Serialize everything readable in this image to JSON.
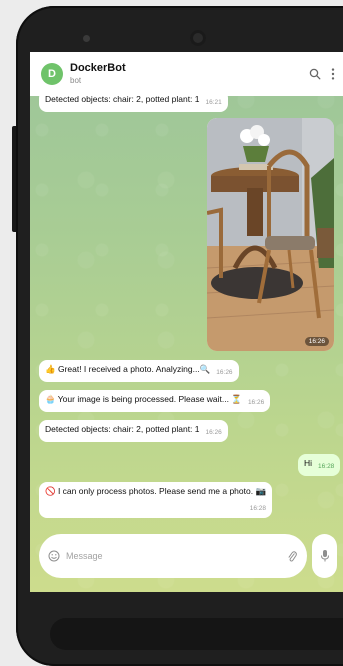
{
  "header": {
    "avatar_letter": "D",
    "title": "DockerBot",
    "subtitle": "bot"
  },
  "messages": [
    {
      "text": "Detected objects: chair: 2, potted plant: 1",
      "time": "16:21"
    },
    {
      "photo_time": "16:26"
    },
    {
      "text": "👍 Great! I received a photo. Analyzing...🔍",
      "time": "16:26"
    },
    {
      "text": "🧁 Your image is being processed. Please wait... ⏳",
      "time": "16:26"
    },
    {
      "text": "Detected objects: chair: 2, potted plant: 1",
      "time": "16:26"
    },
    {
      "text": "Hi",
      "time": "16:28"
    },
    {
      "text": "🚫 I can only process photos. Please send me a photo. 📷",
      "time": "16:28"
    }
  ],
  "composer": {
    "placeholder": "Message"
  },
  "icons": {
    "search": "search-icon",
    "menu": "more-vertical-icon",
    "emoji": "emoji-icon",
    "attach": "paperclip-icon",
    "mic": "microphone-icon"
  },
  "colors": {
    "accent": "#6fc36a",
    "outgoing_bubble": "#e6ffd8"
  }
}
